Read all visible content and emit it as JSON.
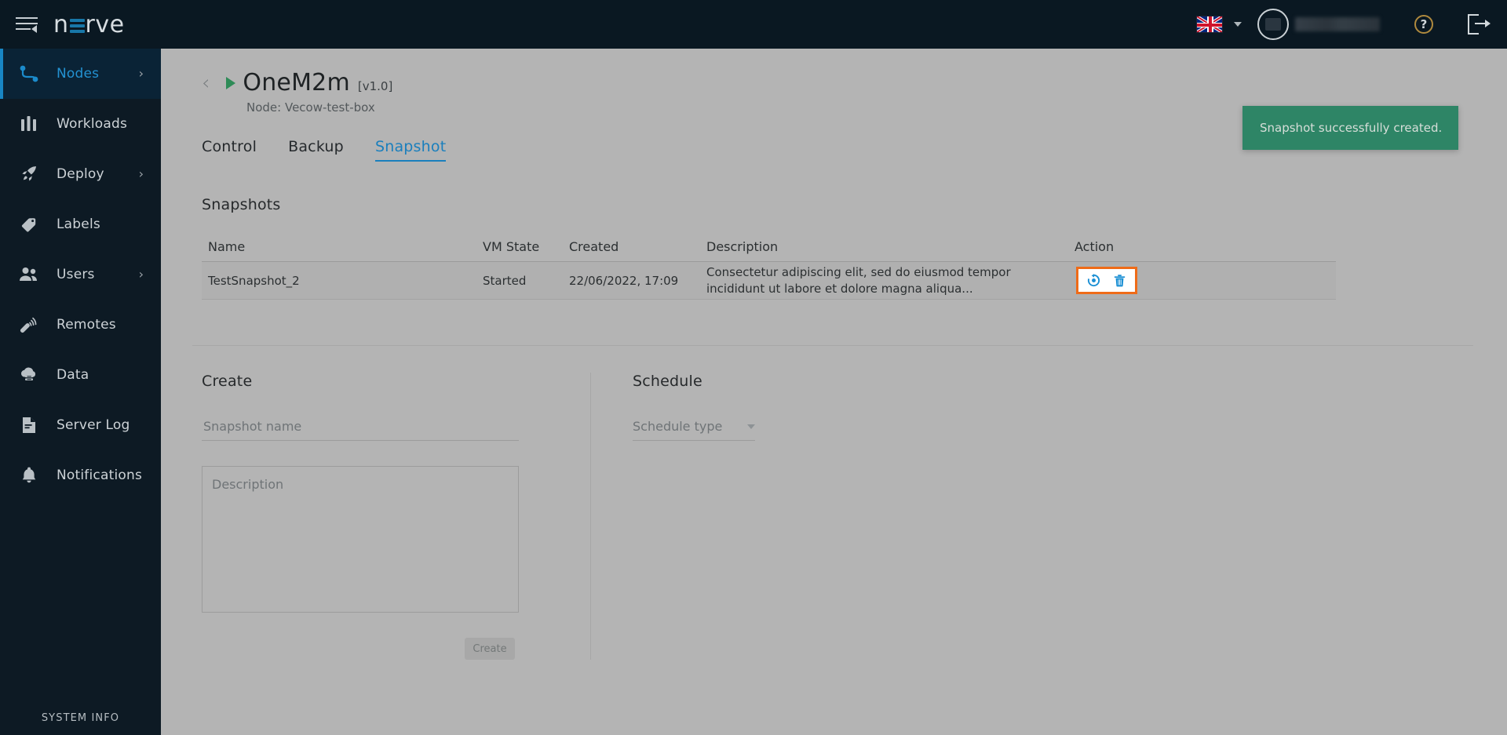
{
  "header": {
    "logo_text_left": "n",
    "logo_text_right": "rve",
    "menu_icon": "hamburger-collapse-icon",
    "language": "en-gb",
    "help_label": "?",
    "logout_icon": "logout-icon"
  },
  "sidebar": {
    "items": [
      {
        "label": "Nodes",
        "icon": "nodes-icon",
        "active": true,
        "chevron": "›"
      },
      {
        "label": "Workloads",
        "icon": "workloads-icon",
        "active": false,
        "chevron": ""
      },
      {
        "label": "Deploy",
        "icon": "deploy-rocket-icon",
        "active": false,
        "chevron": "›"
      },
      {
        "label": "Labels",
        "icon": "labels-tag-icon",
        "active": false,
        "chevron": ""
      },
      {
        "label": "Users",
        "icon": "users-icon",
        "active": false,
        "chevron": "›"
      },
      {
        "label": "Remotes",
        "icon": "remotes-icon",
        "active": false,
        "chevron": ""
      },
      {
        "label": "Data",
        "icon": "data-cloud-icon",
        "active": false,
        "chevron": ""
      },
      {
        "label": "Server Log",
        "icon": "server-log-icon",
        "active": false,
        "chevron": ""
      },
      {
        "label": "Notifications",
        "icon": "bell-icon",
        "active": false,
        "chevron": ""
      }
    ],
    "footer_label": "SYSTEM INFO"
  },
  "page": {
    "back_chevron": "‹",
    "title": "OneM2m",
    "version": "[v1.0]",
    "subtitle": "Node: Vecow-test-box",
    "status_icon": "play-triangle-icon"
  },
  "tabs": [
    {
      "label": "Control",
      "active": false
    },
    {
      "label": "Backup",
      "active": false
    },
    {
      "label": "Snapshot",
      "active": true
    }
  ],
  "snapshots": {
    "section_title": "Snapshots",
    "columns": [
      "Name",
      "VM State",
      "Created",
      "Description",
      "Action"
    ],
    "rows": [
      {
        "name": "TestSnapshot_2",
        "vm_state": "Started",
        "created": "22/06/2022, 17:09",
        "description": "Consectetur adipiscing elit, sed do eiusmod tempor incididunt ut labore et dolore magna aliqua...",
        "actions": [
          "restore-icon",
          "delete-trash-icon"
        ]
      }
    ],
    "highlight_color": "#ef6b18",
    "action_icon_color": "#1a8fd4"
  },
  "create": {
    "title": "Create",
    "name_value": "",
    "name_placeholder": "Snapshot name",
    "description_value": "",
    "description_placeholder": "Description",
    "submit_label": "Create"
  },
  "schedule": {
    "title": "Schedule",
    "type_placeholder": "Schedule type",
    "type_value": ""
  },
  "toast": {
    "message": "Snapshot successfully created.",
    "color": "#2e8566"
  }
}
